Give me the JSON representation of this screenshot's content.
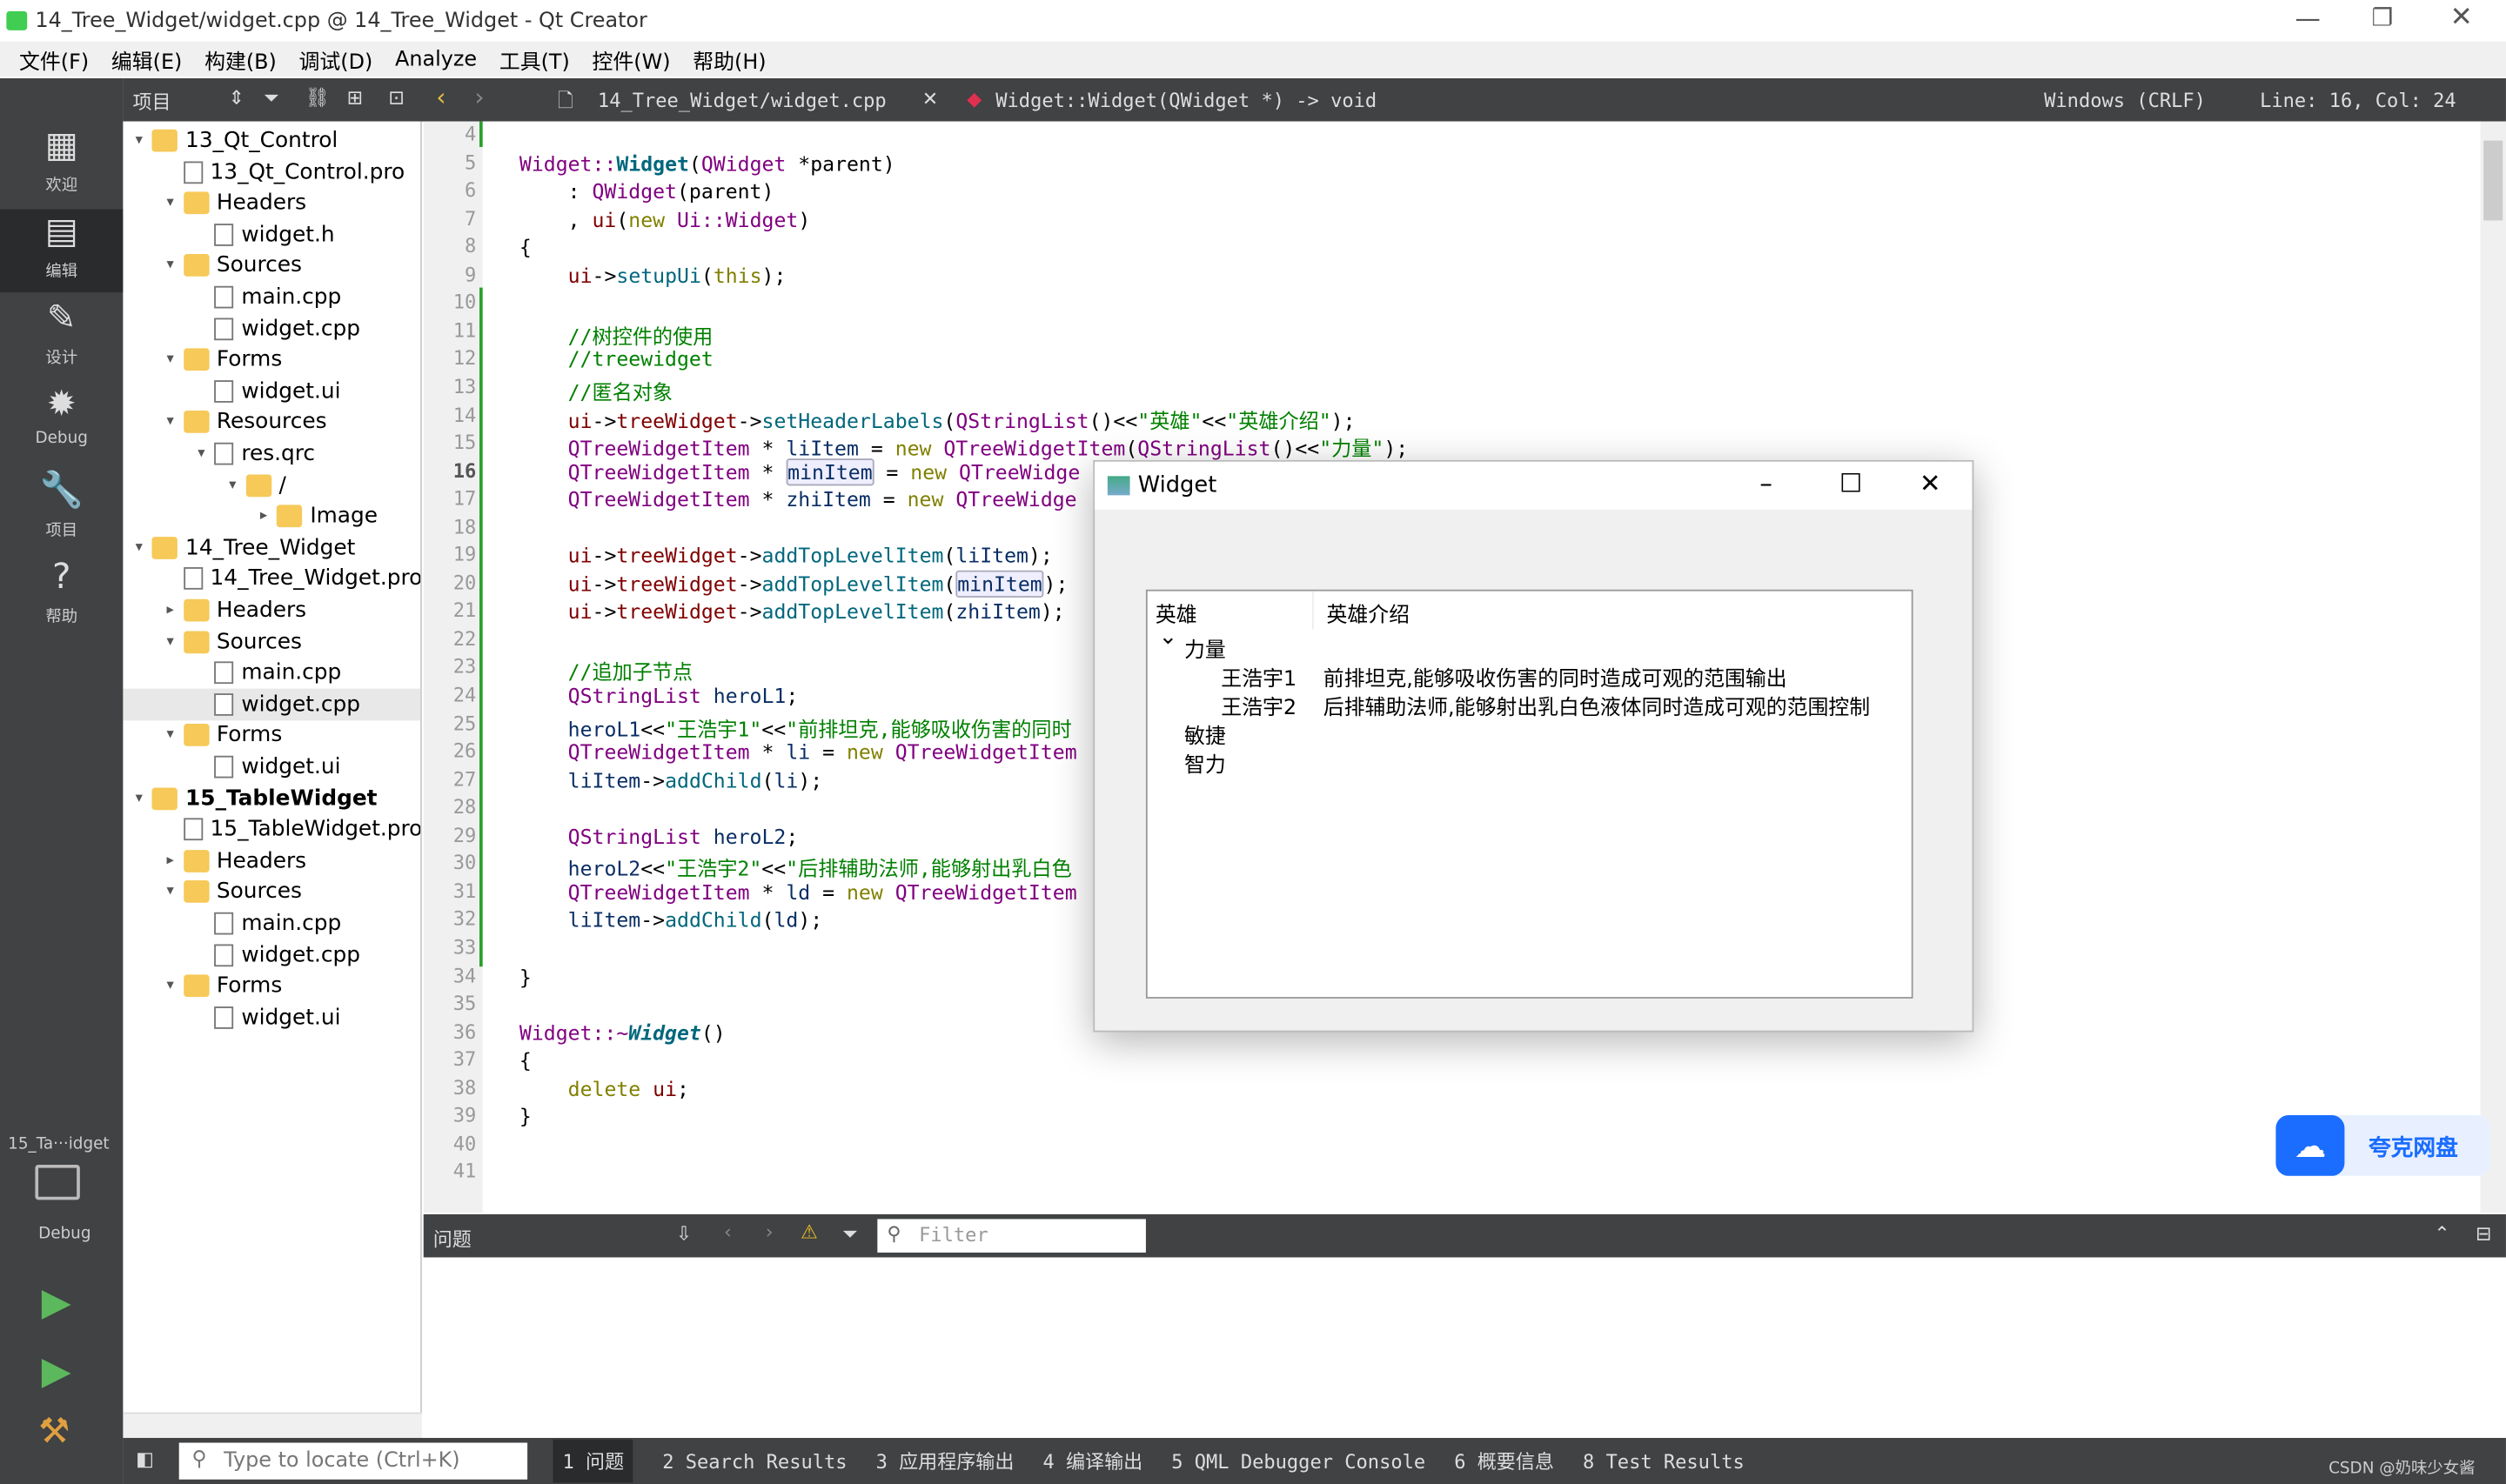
{
  "window": {
    "title": "14_Tree_Widget/widget.cpp @ 14_Tree_Widget - Qt Creator"
  },
  "menu": [
    "文件(F)",
    "编辑(E)",
    "构建(B)",
    "调试(D)",
    "Analyze",
    "工具(T)",
    "控件(W)",
    "帮助(H)"
  ],
  "toolbar": {
    "project_label": "项目",
    "file": "14_Tree_Widget/widget.cpp",
    "symbol": "Widget::Widget(QWidget *) -> void",
    "encoding": "Windows (CRLF)",
    "position": "Line: 16, Col: 24"
  },
  "modes": [
    {
      "label": "欢迎",
      "icon": "grid-icon"
    },
    {
      "label": "编辑",
      "icon": "edit-icon"
    },
    {
      "label": "设计",
      "icon": "pencil-icon"
    },
    {
      "label": "Debug",
      "icon": "bug-icon"
    },
    {
      "label": "项目",
      "icon": "wrench-icon"
    },
    {
      "label": "帮助",
      "icon": "help-icon"
    }
  ],
  "kit": {
    "name": "15_Ta···idget",
    "mode": "Debug"
  },
  "tree": [
    {
      "d": 0,
      "a": "▾",
      "t": "project",
      "l": "13_Qt_Control"
    },
    {
      "d": 1,
      "a": "",
      "t": "file",
      "l": "13_Qt_Control.pro"
    },
    {
      "d": 1,
      "a": "▾",
      "t": "folder",
      "l": "Headers"
    },
    {
      "d": 2,
      "a": "",
      "t": "file",
      "l": "widget.h"
    },
    {
      "d": 1,
      "a": "▾",
      "t": "folder",
      "l": "Sources"
    },
    {
      "d": 2,
      "a": "",
      "t": "file",
      "l": "main.cpp"
    },
    {
      "d": 2,
      "a": "",
      "t": "file",
      "l": "widget.cpp"
    },
    {
      "d": 1,
      "a": "▾",
      "t": "folder",
      "l": "Forms"
    },
    {
      "d": 2,
      "a": "",
      "t": "file",
      "l": "widget.ui"
    },
    {
      "d": 1,
      "a": "▾",
      "t": "folder",
      "l": "Resources"
    },
    {
      "d": 2,
      "a": "▾",
      "t": "file",
      "l": "res.qrc"
    },
    {
      "d": 3,
      "a": "▾",
      "t": "folder",
      "l": "/"
    },
    {
      "d": 4,
      "a": "▸",
      "t": "folder",
      "l": "Image"
    },
    {
      "d": 0,
      "a": "▾",
      "t": "project",
      "l": "14_Tree_Widget"
    },
    {
      "d": 1,
      "a": "",
      "t": "file",
      "l": "14_Tree_Widget.pro"
    },
    {
      "d": 1,
      "a": "▸",
      "t": "folder",
      "l": "Headers"
    },
    {
      "d": 1,
      "a": "▾",
      "t": "folder",
      "l": "Sources"
    },
    {
      "d": 2,
      "a": "",
      "t": "file",
      "l": "main.cpp"
    },
    {
      "d": 2,
      "a": "",
      "t": "file",
      "l": "widget.cpp",
      "sel": true
    },
    {
      "d": 1,
      "a": "▾",
      "t": "folder",
      "l": "Forms"
    },
    {
      "d": 2,
      "a": "",
      "t": "file",
      "l": "widget.ui"
    },
    {
      "d": 0,
      "a": "▾",
      "t": "project",
      "l": "15_TableWidget",
      "bold": true
    },
    {
      "d": 1,
      "a": "",
      "t": "file",
      "l": "15_TableWidget.pro"
    },
    {
      "d": 1,
      "a": "▸",
      "t": "folder",
      "l": "Headers"
    },
    {
      "d": 1,
      "a": "▾",
      "t": "folder",
      "l": "Sources"
    },
    {
      "d": 2,
      "a": "",
      "t": "file",
      "l": "main.cpp"
    },
    {
      "d": 2,
      "a": "",
      "t": "file",
      "l": "widget.cpp"
    },
    {
      "d": 1,
      "a": "▾",
      "t": "folder",
      "l": "Forms"
    },
    {
      "d": 2,
      "a": "",
      "t": "file",
      "l": "widget.ui"
    }
  ],
  "code": [
    {
      "n": 4,
      "t": []
    },
    {
      "n": 5,
      "t": [
        [
          "k",
          "Widget::"
        ],
        [
          "fb",
          "Widget"
        ],
        [
          "p",
          "("
        ],
        [
          "k",
          "QWidget"
        ],
        [
          "p",
          " *parent)"
        ]
      ]
    },
    {
      "n": 6,
      "t": [
        [
          "p",
          "    : "
        ],
        [
          "k",
          "QWidget"
        ],
        [
          "p",
          "(parent)"
        ]
      ]
    },
    {
      "n": 7,
      "t": [
        [
          "p",
          "    , "
        ],
        [
          "m",
          "ui"
        ],
        [
          "p",
          "("
        ],
        [
          "kw",
          "new"
        ],
        [
          "p",
          " "
        ],
        [
          "k",
          "Ui::Widget"
        ],
        [
          "p",
          ")"
        ]
      ]
    },
    {
      "n": 8,
      "t": [
        [
          "p",
          "{"
        ]
      ]
    },
    {
      "n": 9,
      "t": [
        [
          "p",
          "    "
        ],
        [
          "m",
          "ui"
        ],
        [
          "p",
          "->"
        ],
        [
          "f",
          "setupUi"
        ],
        [
          "p",
          "("
        ],
        [
          "kw",
          "this"
        ],
        [
          "p",
          ");"
        ]
      ]
    },
    {
      "n": 10,
      "t": []
    },
    {
      "n": 11,
      "t": [
        [
          "c",
          "    //树控件的使用"
        ]
      ]
    },
    {
      "n": 12,
      "t": [
        [
          "c",
          "    //treewidget"
        ]
      ]
    },
    {
      "n": 13,
      "t": [
        [
          "c",
          "    //匿名对象"
        ]
      ]
    },
    {
      "n": 14,
      "t": [
        [
          "p",
          "    "
        ],
        [
          "m",
          "ui"
        ],
        [
          "p",
          "->"
        ],
        [
          "m",
          "treeWidget"
        ],
        [
          "p",
          "->"
        ],
        [
          "f",
          "setHeaderLabels"
        ],
        [
          "p",
          "("
        ],
        [
          "k",
          "QStringList"
        ],
        [
          "p",
          "()<<"
        ],
        [
          "s",
          "\"英雄\""
        ],
        [
          "p",
          "<<"
        ],
        [
          "s",
          "\"英雄介绍\""
        ],
        [
          "p",
          ");"
        ]
      ]
    },
    {
      "n": 15,
      "t": [
        [
          "p",
          "    "
        ],
        [
          "k",
          "QTreeWidgetItem"
        ],
        [
          "p",
          " * "
        ],
        [
          "v",
          "liItem"
        ],
        [
          "p",
          " = "
        ],
        [
          "kw",
          "new"
        ],
        [
          "p",
          " "
        ],
        [
          "k",
          "QTreeWidgetItem"
        ],
        [
          "p",
          "("
        ],
        [
          "k",
          "QStringList"
        ],
        [
          "p",
          "()<<"
        ],
        [
          "s",
          "\"力量\""
        ],
        [
          "p",
          ");"
        ]
      ]
    },
    {
      "n": 16,
      "t": [
        [
          "p",
          "    "
        ],
        [
          "k",
          "QTreeWidgetItem"
        ],
        [
          "p",
          " * "
        ],
        [
          "vh",
          "minItem"
        ],
        [
          "p",
          " = "
        ],
        [
          "kw",
          "new"
        ],
        [
          "p",
          " "
        ],
        [
          "k",
          "QTreeWidge"
        ]
      ]
    },
    {
      "n": 17,
      "t": [
        [
          "p",
          "    "
        ],
        [
          "k",
          "QTreeWidgetItem"
        ],
        [
          "p",
          " * "
        ],
        [
          "v",
          "zhiItem"
        ],
        [
          "p",
          " = "
        ],
        [
          "kw",
          "new"
        ],
        [
          "p",
          " "
        ],
        [
          "k",
          "QTreeWidge"
        ]
      ]
    },
    {
      "n": 18,
      "t": []
    },
    {
      "n": 19,
      "t": [
        [
          "p",
          "    "
        ],
        [
          "m",
          "ui"
        ],
        [
          "p",
          "->"
        ],
        [
          "m",
          "treeWidget"
        ],
        [
          "p",
          "->"
        ],
        [
          "f",
          "addTopLevelItem"
        ],
        [
          "p",
          "("
        ],
        [
          "v",
          "liItem"
        ],
        [
          "p",
          ");"
        ]
      ]
    },
    {
      "n": 20,
      "t": [
        [
          "p",
          "    "
        ],
        [
          "m",
          "ui"
        ],
        [
          "p",
          "->"
        ],
        [
          "m",
          "treeWidget"
        ],
        [
          "p",
          "->"
        ],
        [
          "f",
          "addTopLevelItem"
        ],
        [
          "p",
          "("
        ],
        [
          "vh",
          "minItem"
        ],
        [
          "p",
          ");"
        ]
      ]
    },
    {
      "n": 21,
      "t": [
        [
          "p",
          "    "
        ],
        [
          "m",
          "ui"
        ],
        [
          "p",
          "->"
        ],
        [
          "m",
          "treeWidget"
        ],
        [
          "p",
          "->"
        ],
        [
          "f",
          "addTopLevelItem"
        ],
        [
          "p",
          "("
        ],
        [
          "v",
          "zhiItem"
        ],
        [
          "p",
          ");"
        ]
      ]
    },
    {
      "n": 22,
      "t": []
    },
    {
      "n": 23,
      "t": [
        [
          "c",
          "    //追加子节点"
        ]
      ]
    },
    {
      "n": 24,
      "t": [
        [
          "p",
          "    "
        ],
        [
          "k",
          "QStringList"
        ],
        [
          "v",
          " heroL1"
        ],
        [
          "p",
          ";"
        ]
      ]
    },
    {
      "n": 25,
      "t": [
        [
          "p",
          "    "
        ],
        [
          "v",
          "heroL1"
        ],
        [
          "p",
          "<<"
        ],
        [
          "s",
          "\"王浩宇1\""
        ],
        [
          "p",
          "<<"
        ],
        [
          "s",
          "\"前排坦克,能够吸收伤害的同时"
        ]
      ]
    },
    {
      "n": 26,
      "t": [
        [
          "p",
          "    "
        ],
        [
          "k",
          "QTreeWidgetItem"
        ],
        [
          "p",
          " * "
        ],
        [
          "v",
          "li"
        ],
        [
          "p",
          " = "
        ],
        [
          "kw",
          "new"
        ],
        [
          "p",
          " "
        ],
        [
          "k",
          "QTreeWidgetItem"
        ]
      ]
    },
    {
      "n": 27,
      "t": [
        [
          "p",
          "    "
        ],
        [
          "v",
          "liItem"
        ],
        [
          "p",
          "->"
        ],
        [
          "f",
          "addChild"
        ],
        [
          "p",
          "("
        ],
        [
          "v",
          "li"
        ],
        [
          "p",
          ");"
        ]
      ]
    },
    {
      "n": 28,
      "t": []
    },
    {
      "n": 29,
      "t": [
        [
          "p",
          "    "
        ],
        [
          "k",
          "QStringList"
        ],
        [
          "v",
          " heroL2"
        ],
        [
          "p",
          ";"
        ]
      ]
    },
    {
      "n": 30,
      "t": [
        [
          "p",
          "    "
        ],
        [
          "v",
          "heroL2"
        ],
        [
          "p",
          "<<"
        ],
        [
          "s",
          "\"王浩宇2\""
        ],
        [
          "p",
          "<<"
        ],
        [
          "s",
          "\"后排辅助法师,能够射出乳白色"
        ]
      ]
    },
    {
      "n": 31,
      "t": [
        [
          "p",
          "    "
        ],
        [
          "k",
          "QTreeWidgetItem"
        ],
        [
          "p",
          " * "
        ],
        [
          "v",
          "ld"
        ],
        [
          "p",
          " = "
        ],
        [
          "kw",
          "new"
        ],
        [
          "p",
          " "
        ],
        [
          "k",
          "QTreeWidgetItem"
        ]
      ]
    },
    {
      "n": 32,
      "t": [
        [
          "p",
          "    "
        ],
        [
          "v",
          "liItem"
        ],
        [
          "p",
          "->"
        ],
        [
          "f",
          "addChild"
        ],
        [
          "p",
          "("
        ],
        [
          "v",
          "ld"
        ],
        [
          "p",
          ");"
        ]
      ]
    },
    {
      "n": 33,
      "t": []
    },
    {
      "n": 34,
      "t": [
        [
          "p",
          "}"
        ]
      ]
    },
    {
      "n": 35,
      "t": []
    },
    {
      "n": 36,
      "t": [
        [
          "k",
          "Widget::~"
        ],
        [
          "fi",
          "Widget"
        ],
        [
          "p",
          "()"
        ]
      ]
    },
    {
      "n": 37,
      "t": [
        [
          "p",
          "{"
        ]
      ]
    },
    {
      "n": 38,
      "t": [
        [
          "p",
          "    "
        ],
        [
          "kw",
          "delete"
        ],
        [
          "p",
          " "
        ],
        [
          "m",
          "ui"
        ],
        [
          "p",
          ";"
        ]
      ]
    },
    {
      "n": 39,
      "t": [
        [
          "p",
          "}"
        ]
      ]
    },
    {
      "n": 40,
      "t": []
    },
    {
      "n": 41,
      "t": []
    }
  ],
  "dialog": {
    "title": "Widget",
    "headers": [
      "英雄",
      "英雄介绍"
    ],
    "rows": [
      {
        "level": 0,
        "expanded": true,
        "name": "力量",
        "desc": ""
      },
      {
        "level": 1,
        "name": "王浩宇1",
        "desc": "前排坦克,能够吸收伤害的同时造成可观的范围输出"
      },
      {
        "level": 1,
        "name": "王浩宇2",
        "desc": "后排辅助法师,能够射出乳白色液体同时造成可观的范围控制"
      },
      {
        "level": 0,
        "name": "敏捷",
        "desc": ""
      },
      {
        "level": 0,
        "name": "智力",
        "desc": ""
      }
    ]
  },
  "issues": {
    "label": "问题",
    "filter_placeholder": "Filter"
  },
  "status": {
    "locate_placeholder": "Type to locate (Ctrl+K)",
    "tabs": [
      "1 问题",
      "2 Search Results",
      "3 应用程序输出",
      "4 编译输出",
      "5 QML Debugger Console",
      "6 概要信息",
      "8 Test Results"
    ],
    "watermark": "CSDN @奶味少女酱"
  },
  "badge": {
    "label": "夸克网盘",
    "color": "#1a6dff"
  }
}
